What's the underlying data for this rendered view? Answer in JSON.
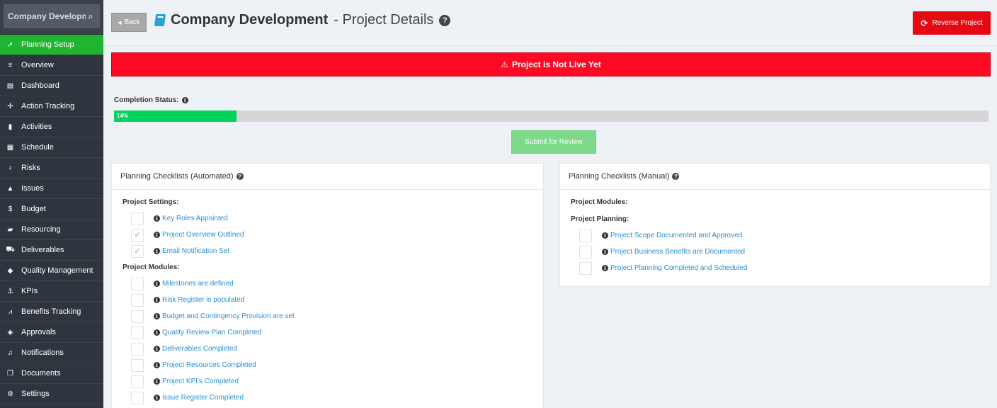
{
  "sidebar": {
    "search_text": "Company Development",
    "items": [
      {
        "label": "Planning Setup",
        "icon": "rocket-icon",
        "glyph": "➚",
        "active": true
      },
      {
        "label": "Overview",
        "icon": "list-icon",
        "glyph": "≡"
      },
      {
        "label": "Dashboard",
        "icon": "dashboard-icon",
        "glyph": "▤"
      },
      {
        "label": "Action Tracking",
        "icon": "crosshair-icon",
        "glyph": "✛"
      },
      {
        "label": "Activities",
        "icon": "bookmark-icon",
        "glyph": "▮"
      },
      {
        "label": "Schedule",
        "icon": "calendar-icon",
        "glyph": "▦"
      },
      {
        "label": "Risks",
        "icon": "lightbulb-icon",
        "glyph": "♁"
      },
      {
        "label": "Issues",
        "icon": "warning-icon",
        "glyph": "▲"
      },
      {
        "label": "Budget",
        "icon": "dollar-icon",
        "glyph": "$"
      },
      {
        "label": "Resourcing",
        "icon": "folder-icon",
        "glyph": "▰"
      },
      {
        "label": "Deliverables",
        "icon": "truck-icon",
        "glyph": "⛟"
      },
      {
        "label": "Quality Management",
        "icon": "tag-icon",
        "glyph": "◆"
      },
      {
        "label": "KPIs",
        "icon": "anchor-icon",
        "glyph": "⚓"
      },
      {
        "label": "Benefits Tracking",
        "icon": "line-chart-icon",
        "glyph": "⩘"
      },
      {
        "label": "Approvals",
        "icon": "gavel-icon",
        "glyph": "◈"
      },
      {
        "label": "Notifications",
        "icon": "bell-icon",
        "glyph": "♫"
      },
      {
        "label": "Documents",
        "icon": "copy-icon",
        "glyph": "❐"
      },
      {
        "label": "Settings",
        "icon": "cogs-icon",
        "glyph": "⚙"
      }
    ]
  },
  "header": {
    "back_label": "Back",
    "title_main": "Company Development",
    "title_sub": "- Project Details",
    "reverse_label": "Reverse Project"
  },
  "alert": {
    "text": "Project is Not Live Yet"
  },
  "completion": {
    "label": "Completion Status:",
    "percent": 14,
    "percent_text": "14%"
  },
  "submit_label": "Submit for Review",
  "automated": {
    "title": "Planning Checklists (Automated)",
    "project_settings_label": "Project Settings:",
    "project_settings": [
      {
        "label": "Key Roles Appointed",
        "checked": false
      },
      {
        "label": "Project Overview Outlined",
        "checked": true
      },
      {
        "label": "Email Notification Set",
        "checked": true
      }
    ],
    "project_modules_label": "Project Modules:",
    "project_modules": [
      {
        "label": "Milestones are defined",
        "checked": false
      },
      {
        "label": "Risk Register is populated",
        "checked": false
      },
      {
        "label": "Budget and Contingency Provision are set",
        "checked": false
      },
      {
        "label": "Quality Review Plan Completed",
        "checked": false
      },
      {
        "label": "Deliverables Completed",
        "checked": false
      },
      {
        "label": "Project Resources Completed",
        "checked": false
      },
      {
        "label": "Project KPI's Completed",
        "checked": false
      },
      {
        "label": "Issue Register Completed",
        "checked": false
      }
    ]
  },
  "manual": {
    "title": "Planning Checklists (Manual)",
    "project_modules_label": "Project Modules:",
    "project_planning_label": "Project Planning:",
    "project_planning": [
      {
        "label": "Project Scope Documented and Approved",
        "checked": false
      },
      {
        "label": "Project Business Benefits are Documented",
        "checked": false
      },
      {
        "label": "Project Planning Completed and Scheduled",
        "checked": false
      }
    ]
  },
  "colors": {
    "sidebar_bg": "#2f353e",
    "active": "#20b530",
    "alert": "#ff0a24",
    "progress": "#00d45a",
    "link": "#2a8fd0",
    "reverse_btn": "#e50914"
  }
}
